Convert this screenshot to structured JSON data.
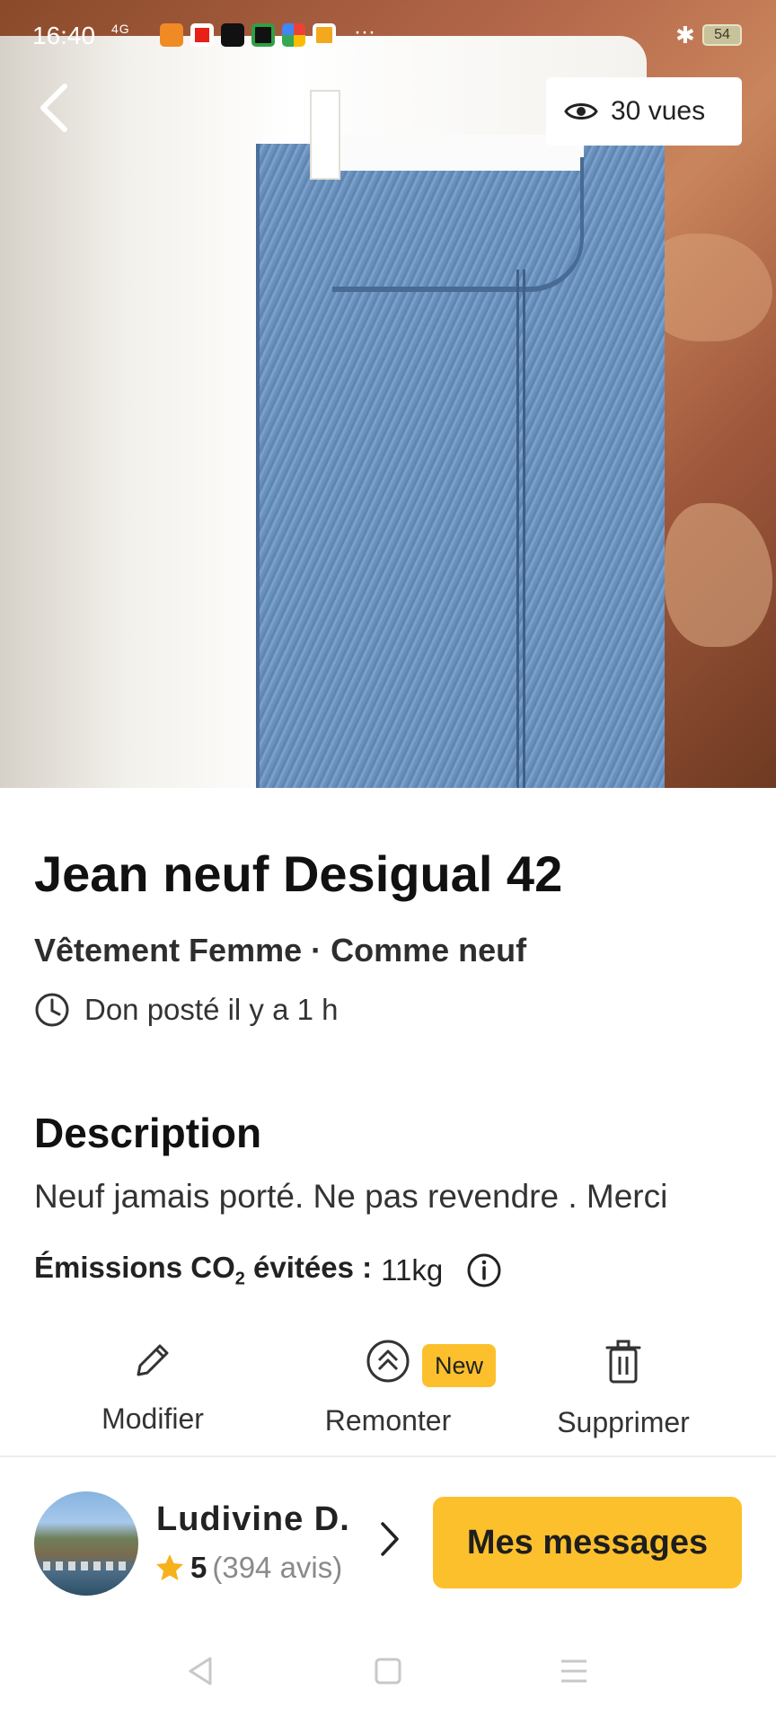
{
  "status_bar": {
    "time": "16:40",
    "network": "4G",
    "battery": "54",
    "more": "···"
  },
  "header": {
    "back_icon": "chevron-left-icon",
    "views_icon": "eye-icon",
    "views_label": "30 vues"
  },
  "listing": {
    "title": "Jean neuf Desigual 42",
    "subtitle": "Vêtement Femme · Comme neuf",
    "posted_icon": "clock-icon",
    "posted": "Don posté il y a 1 h"
  },
  "description": {
    "heading": "Description",
    "text": "Neuf jamais porté. Ne pas revendre . Merci"
  },
  "emissions": {
    "label_prefix": "Émissions CO",
    "label_sub": "2",
    "label_suffix": " évitées :",
    "value": "11kg",
    "info_icon": "info-icon"
  },
  "actions": {
    "modify": "Modifier",
    "boost": "Remonter",
    "boost_badge": "New",
    "delete": "Supprimer"
  },
  "user": {
    "name": "Ludivine  D.",
    "rating": "5",
    "reviews": "(394 avis)"
  },
  "cta": {
    "messages": "Mes messages"
  },
  "colors": {
    "accent": "#fcc02c",
    "star": "#f5b21c"
  }
}
